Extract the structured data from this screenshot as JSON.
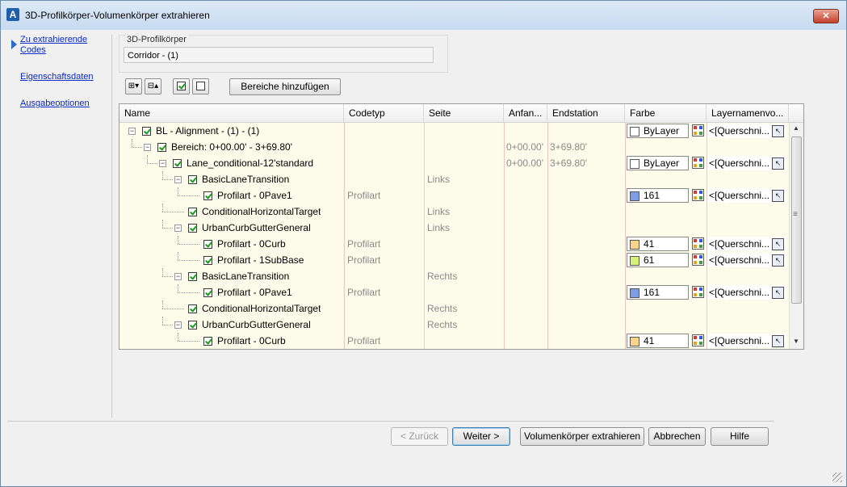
{
  "window": {
    "title": "3D-Profilkörper-Volumenkörper extrahieren",
    "app_icon": "A",
    "close_glyph": "✕"
  },
  "nav": [
    {
      "label_line1": "Zu extrahierende",
      "label_line2": "Codes",
      "active": true
    },
    {
      "label": "Eigenschaftsdaten"
    },
    {
      "label": "Ausgabeoptionen"
    }
  ],
  "corridor": {
    "legend": "3D-Profilkörper",
    "value": "Corridor - (1)"
  },
  "toolbar": {
    "bereiche_label": "Bereiche hinzufügen",
    "expand_glyph": "⊞▾",
    "collapse_glyph": "⊟▴"
  },
  "grid": {
    "headers": {
      "name": "Name",
      "codetyp": "Codetyp",
      "seite": "Seite",
      "anfang": "Anfan...",
      "endstation": "Endstation",
      "farbe": "Farbe",
      "layer": "Layernamenvo..."
    },
    "rows": [
      {
        "level": 0,
        "name": "BL - Alignment - (1) - (1)",
        "expander": "−",
        "codetyp": "",
        "seite": "",
        "anfang": "",
        "end": "",
        "color": {
          "label": "ByLayer",
          "swatch": "#ffffff"
        },
        "layer": "<[Querschni..."
      },
      {
        "level": 1,
        "name": "Bereich: 0+00.00' - 3+69.80'",
        "expander": "−",
        "codetyp": "",
        "seite": "",
        "anfang": "0+00.00'",
        "end": "3+69.80'",
        "color": null,
        "layer": ""
      },
      {
        "level": 2,
        "name": "Lane_conditional-12'standard",
        "expander": "−",
        "codetyp": "",
        "seite": "",
        "anfang": "0+00.00'",
        "end": "3+69.80'",
        "color": {
          "label": "ByLayer",
          "swatch": "#ffffff"
        },
        "layer": "<[Querschni..."
      },
      {
        "level": 3,
        "name": "BasicLaneTransition",
        "expander": "−",
        "codetyp": "",
        "seite": "Links",
        "anfang": "",
        "end": "",
        "color": null,
        "layer": ""
      },
      {
        "level": 4,
        "name": "Profilart - 0Pave1",
        "expander": "",
        "codetyp": "Profilart",
        "seite": "",
        "anfang": "",
        "end": "",
        "color": {
          "label": "161",
          "swatch": "#7d9de6"
        },
        "layer": "<[Querschni..."
      },
      {
        "level": 3,
        "name": "ConditionalHorizontalTarget",
        "expander": "",
        "codetyp": "",
        "seite": "Links",
        "anfang": "",
        "end": "",
        "color": null,
        "layer": ""
      },
      {
        "level": 3,
        "name": "UrbanCurbGutterGeneral",
        "expander": "−",
        "codetyp": "",
        "seite": "Links",
        "anfang": "",
        "end": "",
        "color": null,
        "layer": ""
      },
      {
        "level": 4,
        "name": "Profilart - 0Curb",
        "expander": "",
        "codetyp": "Profilart",
        "seite": "",
        "anfang": "",
        "end": "",
        "color": {
          "label": "41",
          "swatch": "#f8d48a"
        },
        "layer": "<[Querschni..."
      },
      {
        "level": 4,
        "name": "Profilart - 1SubBase",
        "expander": "",
        "codetyp": "Profilart",
        "seite": "",
        "anfang": "",
        "end": "",
        "color": {
          "label": "61",
          "swatch": "#d6f07a"
        },
        "layer": "<[Querschni..."
      },
      {
        "level": 3,
        "name": "BasicLaneTransition",
        "expander": "−",
        "codetyp": "",
        "seite": "Rechts",
        "anfang": "",
        "end": "",
        "color": null,
        "layer": ""
      },
      {
        "level": 4,
        "name": "Profilart - 0Pave1",
        "expander": "",
        "codetyp": "Profilart",
        "seite": "",
        "anfang": "",
        "end": "",
        "color": {
          "label": "161",
          "swatch": "#7d9de6"
        },
        "layer": "<[Querschni..."
      },
      {
        "level": 3,
        "name": "ConditionalHorizontalTarget",
        "expander": "",
        "codetyp": "",
        "seite": "Rechts",
        "anfang": "",
        "end": "",
        "color": null,
        "layer": ""
      },
      {
        "level": 3,
        "name": "UrbanCurbGutterGeneral",
        "expander": "−",
        "codetyp": "",
        "seite": "Rechts",
        "anfang": "",
        "end": "",
        "color": null,
        "layer": ""
      },
      {
        "level": 4,
        "name": "Profilart - 0Curb",
        "expander": "",
        "codetyp": "Profilart",
        "seite": "",
        "anfang": "",
        "end": "",
        "color": {
          "label": "41",
          "swatch": "#f8d48a"
        },
        "layer": "<[Querschni..."
      }
    ],
    "scroll": {
      "up": "▲",
      "down": "▼",
      "grip": "≡"
    },
    "layer_button_glyph": "↖"
  },
  "buttons": {
    "back": "< Zurück",
    "next": "Weiter >",
    "extract": "Volumenkörper extrahieren",
    "cancel": "Abbrechen",
    "help": "Hilfe"
  },
  "colors": {
    "row_bg": "#fdfbe9",
    "link": "#0a2acd",
    "check": "#1b9a1b"
  }
}
